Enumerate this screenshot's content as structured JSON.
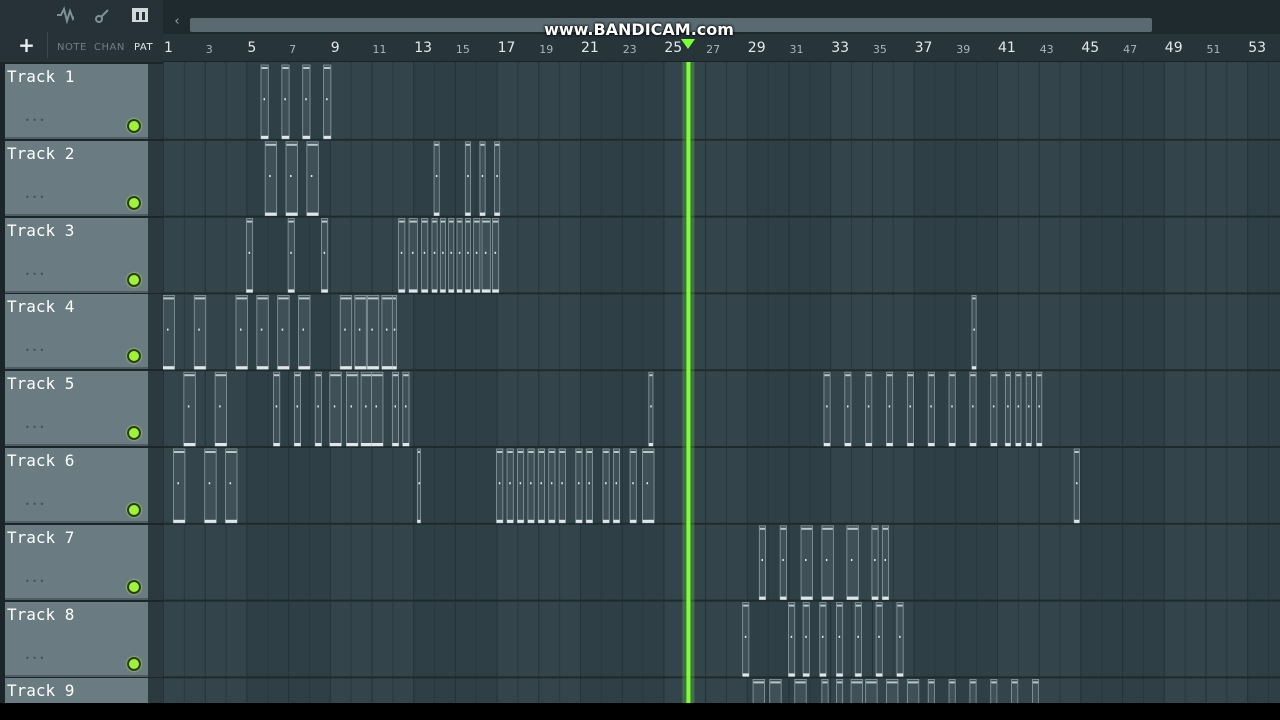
{
  "watermark": "www.BANDICAM.com",
  "toolbar": {
    "add_label": "+",
    "tabs": [
      {
        "label": "NOTE",
        "active": false
      },
      {
        "label": "CHAN",
        "active": false
      },
      {
        "label": "PAT",
        "active": true
      }
    ],
    "icons": [
      "waveform-icon",
      "link-icon",
      "pattern-icon"
    ]
  },
  "ruler": {
    "bars": [
      1,
      3,
      5,
      7,
      9,
      11,
      13,
      15,
      17,
      19,
      21,
      23,
      25,
      27,
      29,
      31,
      33,
      35,
      37,
      39,
      41,
      43,
      45,
      47,
      49,
      51,
      53
    ],
    "labels": [
      "1",
      "3",
      "5",
      "7",
      "9",
      "11",
      "13",
      "15",
      "17",
      "19",
      "21",
      "23",
      "25",
      "27",
      "29",
      "31",
      "33",
      "35",
      "37",
      "39",
      "41",
      "43",
      "45",
      "47",
      "49",
      "51",
      "53"
    ]
  },
  "playhead": {
    "bar": 26.2
  },
  "colors": {
    "playhead": "#7dff3a",
    "led": "#9ef23a",
    "grid_bg": "#2f3f46",
    "clip": "#3f5057"
  },
  "tracks": [
    {
      "label": "Track 1",
      "led": true,
      "clips": [
        [
          5.7,
          0.35
        ],
        [
          6.7,
          0.35
        ],
        [
          7.7,
          0.35
        ],
        [
          8.7,
          0.35
        ]
      ]
    },
    {
      "label": "Track 2",
      "led": true,
      "clips": [
        [
          5.9,
          0.55
        ],
        [
          6.9,
          0.55
        ],
        [
          7.9,
          0.55
        ],
        [
          14.0,
          0.25
        ],
        [
          15.5,
          0.25
        ],
        [
          16.2,
          0.25
        ],
        [
          16.9,
          0.25
        ]
      ]
    },
    {
      "label": "Track 3",
      "led": true,
      "clips": [
        [
          5.0,
          0.3
        ],
        [
          7.0,
          0.3
        ],
        [
          8.6,
          0.3
        ],
        [
          12.3,
          0.3
        ],
        [
          12.8,
          0.4
        ],
        [
          13.4,
          0.3
        ],
        [
          13.9,
          0.25
        ],
        [
          14.3,
          0.25
        ],
        [
          14.7,
          0.25
        ],
        [
          15.1,
          0.25
        ],
        [
          15.5,
          0.25
        ],
        [
          15.9,
          0.3
        ],
        [
          16.3,
          0.4
        ],
        [
          16.8,
          0.3
        ]
      ]
    },
    {
      "label": "Track 4",
      "led": true,
      "clips": [
        [
          1.0,
          0.55
        ],
        [
          2.5,
          0.55
        ],
        [
          4.5,
          0.55
        ],
        [
          5.5,
          0.55
        ],
        [
          6.5,
          0.55
        ],
        [
          7.5,
          0.55
        ],
        [
          9.5,
          0.55
        ],
        [
          10.2,
          0.55
        ],
        [
          10.8,
          0.55
        ],
        [
          11.5,
          0.55
        ],
        [
          12.0,
          0.2
        ],
        [
          39.8,
          0.2
        ]
      ]
    },
    {
      "label": "Track 5",
      "led": true,
      "clips": [
        [
          2.0,
          0.55
        ],
        [
          3.5,
          0.55
        ],
        [
          6.3,
          0.3
        ],
        [
          7.3,
          0.3
        ],
        [
          8.3,
          0.3
        ],
        [
          9.0,
          0.55
        ],
        [
          9.8,
          0.55
        ],
        [
          10.5,
          0.55
        ],
        [
          11.0,
          0.55
        ],
        [
          12.0,
          0.3
        ],
        [
          12.5,
          0.3
        ],
        [
          24.3,
          0.2
        ],
        [
          32.7,
          0.3
        ],
        [
          33.7,
          0.3
        ],
        [
          34.7,
          0.3
        ],
        [
          35.7,
          0.3
        ],
        [
          36.7,
          0.3
        ],
        [
          37.7,
          0.3
        ],
        [
          38.7,
          0.3
        ],
        [
          39.7,
          0.3
        ],
        [
          40.7,
          0.3
        ],
        [
          41.4,
          0.25
        ],
        [
          41.9,
          0.25
        ],
        [
          42.4,
          0.25
        ],
        [
          42.9,
          0.25
        ]
      ]
    },
    {
      "label": "Track 6",
      "led": true,
      "clips": [
        [
          1.5,
          0.55
        ],
        [
          3.0,
          0.55
        ],
        [
          4.0,
          0.55
        ],
        [
          13.2,
          0.15
        ],
        [
          17.0,
          0.3
        ],
        [
          17.5,
          0.3
        ],
        [
          18.0,
          0.3
        ],
        [
          18.5,
          0.3
        ],
        [
          19.0,
          0.3
        ],
        [
          19.5,
          0.3
        ],
        [
          20.0,
          0.3
        ],
        [
          20.8,
          0.3
        ],
        [
          21.3,
          0.3
        ],
        [
          22.1,
          0.3
        ],
        [
          22.6,
          0.3
        ],
        [
          23.4,
          0.3
        ],
        [
          24.0,
          0.55
        ],
        [
          44.7,
          0.25
        ]
      ]
    },
    {
      "label": "Track 7",
      "led": true,
      "clips": [
        [
          29.6,
          0.3
        ],
        [
          30.6,
          0.3
        ],
        [
          31.6,
          0.55
        ],
        [
          32.6,
          0.55
        ],
        [
          33.8,
          0.55
        ],
        [
          35.0,
          0.3
        ],
        [
          35.5,
          0.3
        ]
      ]
    },
    {
      "label": "Track 8",
      "led": true,
      "clips": [
        [
          28.8,
          0.3
        ],
        [
          31.0,
          0.3
        ],
        [
          31.7,
          0.3
        ],
        [
          32.5,
          0.3
        ],
        [
          33.3,
          0.3
        ],
        [
          34.2,
          0.3
        ],
        [
          35.2,
          0.3
        ],
        [
          36.2,
          0.3
        ]
      ]
    },
    {
      "label": "Track 9",
      "led": true,
      "clips": [
        [
          29.3,
          0.55
        ],
        [
          30.1,
          0.55
        ],
        [
          31.3,
          0.55
        ],
        [
          32.6,
          0.3
        ],
        [
          33.3,
          0.3
        ],
        [
          34.0,
          0.55
        ],
        [
          34.7,
          0.55
        ],
        [
          35.7,
          0.55
        ],
        [
          36.7,
          0.55
        ],
        [
          37.7,
          0.3
        ],
        [
          38.7,
          0.3
        ],
        [
          39.7,
          0.3
        ],
        [
          40.7,
          0.3
        ],
        [
          41.7,
          0.3
        ],
        [
          42.7,
          0.3
        ]
      ]
    }
  ]
}
